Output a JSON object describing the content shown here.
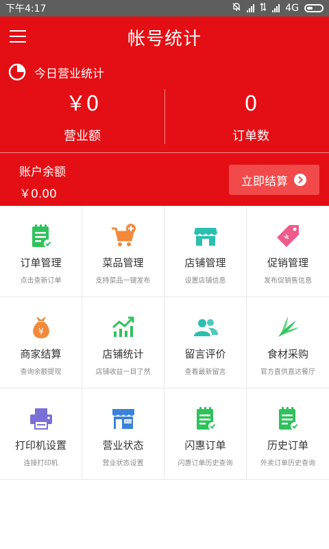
{
  "status_bar": {
    "time": "下午4:17",
    "network": "4G"
  },
  "header": {
    "title": "帐号统计"
  },
  "today": {
    "label": "今日营业统计",
    "revenue_value": "￥0",
    "revenue_label": "营业额",
    "orders_value": "0",
    "orders_label": "订单数"
  },
  "balance": {
    "label": "账户余额",
    "value": "￥0.00",
    "settle_label": "立即结算"
  },
  "menu": [
    {
      "title": "订单管理",
      "sub": "点击查新订单",
      "icon": "order-list-icon"
    },
    {
      "title": "菜品管理",
      "sub": "支持菜品一键发布",
      "icon": "cart-add-icon"
    },
    {
      "title": "店铺管理",
      "sub": "设置店铺信息",
      "icon": "store-icon"
    },
    {
      "title": "促销管理",
      "sub": "发布促销售信息",
      "icon": "promo-tag-icon"
    },
    {
      "title": "商家结算",
      "sub": "查询余额提现",
      "icon": "money-bag-icon"
    },
    {
      "title": "店铺统计",
      "sub": "店铺收益一目了然",
      "icon": "trend-chart-icon"
    },
    {
      "title": "留言评价",
      "sub": "查看最新留言",
      "icon": "users-icon"
    },
    {
      "title": "食材采购",
      "sub": "官方直供直达餐厅",
      "icon": "vegetable-icon"
    },
    {
      "title": "打印机设置",
      "sub": "连接打印机",
      "icon": "printer-icon"
    },
    {
      "title": "营业状态",
      "sub": "营业状态设置",
      "icon": "open-shop-icon"
    },
    {
      "title": "闪惠订单",
      "sub": "闪惠订单历史查询",
      "icon": "order-list-icon"
    },
    {
      "title": "历史订单",
      "sub": "外卖订单历史查询",
      "icon": "order-list-icon"
    }
  ],
  "colors": {
    "brand_red": "#e30f14",
    "settle_button": "#f24a4a",
    "icon_green": "#2fc25b",
    "icon_orange": "#f28a3a",
    "icon_teal": "#2bbfae",
    "icon_pink": "#ef5a8a",
    "icon_purple": "#7a6fd6",
    "icon_blue": "#3a83d8"
  }
}
